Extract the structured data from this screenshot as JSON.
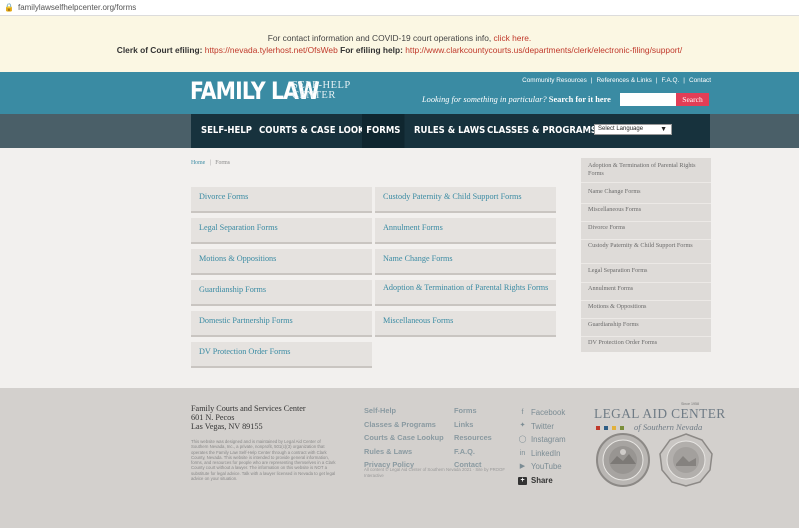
{
  "browser": {
    "url": "familylawselfhelpcenter.org/forms"
  },
  "notice": {
    "line1_text": "For contact information and COVID-19 court operations info,",
    "line1_link": "click here.",
    "efiling_label": "Clerk of Court efiling:",
    "efiling_url": "https://nevada.tylerhost.net/OfsWeb",
    "help_label": "For efiling help:",
    "help_url": "http://www.clarkcountycourts.us/departments/clerk/electronic-filing/support/"
  },
  "header": {
    "logo_main": "FAMILY LAW",
    "logo_sub_1": "SELF-HELP",
    "logo_sub_2": "CENTER",
    "toplinks": [
      "Community Resources",
      "References & Links",
      "F.A.Q.",
      "Contact"
    ],
    "search_prompt": "Looking for something in particular?",
    "search_cta": "Search for it here",
    "search_placeholder": "",
    "search_button": "Search"
  },
  "nav": {
    "items": [
      "SELF-HELP",
      "COURTS & CASE LOOKUP",
      "FORMS",
      "RULES & LAWS",
      "CLASSES & PROGRAMS"
    ],
    "active": "FORMS",
    "language": "Select Language"
  },
  "breadcrumb": {
    "home": "Home",
    "sep": "|",
    "current": "Forms"
  },
  "forms": {
    "left": [
      "Divorce Forms",
      "Legal Separation Forms",
      "Motions & Oppositions",
      "Guardianship Forms",
      "Domestic Partnership Forms",
      "DV Protection Order Forms"
    ],
    "right": [
      "Custody Paternity & Child Support Forms",
      "Annulment Forms",
      "Name Change Forms",
      "Adoption & Termination of Parental Rights Forms",
      "Miscellaneous Forms"
    ]
  },
  "sidebar": {
    "items": [
      "Adoption & Termination of Parental Rights Forms",
      "Name Change Forms",
      "Miscellaneous Forms",
      "Divorce Forms",
      "Custody Paternity & Child Support Forms",
      "Legal Separation Forms",
      "Annulment Forms",
      "Motions & Oppositions",
      "Guardianship Forms",
      "DV Protection Order Forms"
    ]
  },
  "footer": {
    "address": [
      "Family Courts and Services Center",
      "601 N. Pecos",
      "Las Vegas, NV 89155"
    ],
    "disclaimer": "This website was designed and is maintained by Legal Aid Center of Southern Nevada, Inc., a private, nonprofit, 501(c)(3) organization that operates the Family Law Self-Help Center through a contract with Clark County, Nevada. This website is intended to provide general information, forms, and resources for people who are representing themselves in a Clark County court without a lawyer. The information on this website is NOT a substitute for legal advice. Talk with a lawyer licensed in Nevada to get legal advice on your situation.",
    "col1": [
      "Self-Help",
      "Classes & Programs",
      "Courts & Case Lookup",
      "Rules & Laws",
      "Privacy Policy"
    ],
    "col2": [
      "Forms",
      "Links",
      "Resources",
      "F.A.Q.",
      "Contact"
    ],
    "copyright": "All content © Legal Aid Center of Southern Nevada 2021 · Site by PROOF Interactive",
    "social": [
      "Facebook",
      "Twitter",
      "Instagram",
      "LinkedIn",
      "YouTube",
      "Share"
    ],
    "legal_aid_since": "Since 1958",
    "legal_aid_title": "LEGAL AID CENTER",
    "legal_aid_sub": "of Southern Nevada",
    "square_colors": [
      "#c0392b",
      "#2e5e86",
      "#e2b13c",
      "#7a8e3a"
    ]
  }
}
